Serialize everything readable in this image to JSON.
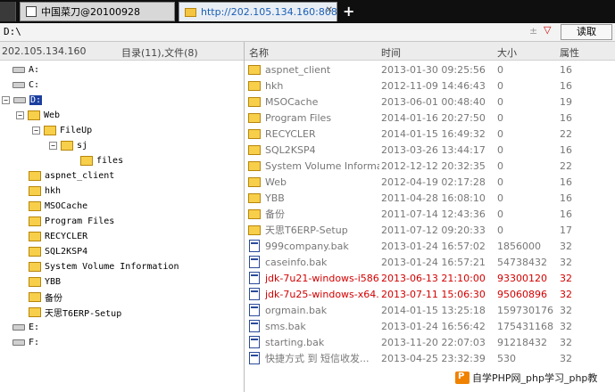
{
  "tabs": [
    {
      "label": ""
    },
    {
      "label": "中国菜刀@20100928"
    },
    {
      "label": "http://202.105.134.160:8080..."
    }
  ],
  "new_tab_label": "+",
  "address": {
    "path": "D:\\",
    "read_label": "读取",
    "controls": "±",
    "dropdown": "▽"
  },
  "left": {
    "ip": "202.105.134.160",
    "counts": "目录(11),文件(8)",
    "tree": [
      {
        "label": "A:",
        "type": "drive"
      },
      {
        "label": "C:",
        "type": "drive"
      },
      {
        "label": "D:",
        "type": "drive"
      },
      {
        "label": "Web",
        "type": "folder"
      },
      {
        "label": "FileUp",
        "type": "folder"
      },
      {
        "label": "sj",
        "type": "folder"
      },
      {
        "label": "files",
        "type": "folder"
      },
      {
        "label": "aspnet_client",
        "type": "folder"
      },
      {
        "label": "hkh",
        "type": "folder"
      },
      {
        "label": "MSOCache",
        "type": "folder"
      },
      {
        "label": "Program Files",
        "type": "folder"
      },
      {
        "label": "RECYCLER",
        "type": "folder"
      },
      {
        "label": "SQL2KSP4",
        "type": "folder"
      },
      {
        "label": "System Volume Information",
        "type": "folder"
      },
      {
        "label": "YBB",
        "type": "folder"
      },
      {
        "label": "备份",
        "type": "folder"
      },
      {
        "label": "天思T6ERP-Setup",
        "type": "folder"
      },
      {
        "label": "E:",
        "type": "drive"
      },
      {
        "label": "F:",
        "type": "drive"
      }
    ]
  },
  "columns": {
    "name": "名称",
    "time": "时间",
    "size": "大小",
    "attr": "属性"
  },
  "files": [
    {
      "name": "aspnet_client",
      "time": "2013-01-30 09:25:56",
      "size": "0",
      "attr": "16",
      "type": "folder"
    },
    {
      "name": "hkh",
      "time": "2012-11-09 14:46:43",
      "size": "0",
      "attr": "16",
      "type": "folder"
    },
    {
      "name": "MSOCache",
      "time": "2013-06-01 00:48:40",
      "size": "0",
      "attr": "19",
      "type": "folder"
    },
    {
      "name": "Program Files",
      "time": "2014-01-16 20:27:50",
      "size": "0",
      "attr": "16",
      "type": "folder"
    },
    {
      "name": "RECYCLER",
      "time": "2014-01-15 16:49:32",
      "size": "0",
      "attr": "22",
      "type": "folder"
    },
    {
      "name": "SQL2KSP4",
      "time": "2013-03-26 13:44:17",
      "size": "0",
      "attr": "16",
      "type": "folder"
    },
    {
      "name": "System Volume Informati...",
      "time": "2012-12-12 20:32:35",
      "size": "0",
      "attr": "22",
      "type": "folder"
    },
    {
      "name": "Web",
      "time": "2012-04-19 02:17:28",
      "size": "0",
      "attr": "16",
      "type": "folder"
    },
    {
      "name": "YBB",
      "time": "2011-04-28 16:08:10",
      "size": "0",
      "attr": "16",
      "type": "folder"
    },
    {
      "name": "备份",
      "time": "2011-07-14 12:43:36",
      "size": "0",
      "attr": "16",
      "type": "folder"
    },
    {
      "name": "天思T6ERP-Setup",
      "time": "2011-07-12 09:20:33",
      "size": "0",
      "attr": "17",
      "type": "folder"
    },
    {
      "name": "999company.bak",
      "time": "2013-01-24 16:57:02",
      "size": "1856000",
      "attr": "32",
      "type": "file"
    },
    {
      "name": "caseinfo.bak",
      "time": "2013-01-24 16:57:21",
      "size": "54738432",
      "attr": "32",
      "type": "file"
    },
    {
      "name": "jdk-7u21-windows-i586.e...",
      "time": "2013-06-13 21:10:00",
      "size": "93300120",
      "attr": "32",
      "type": "file",
      "red": true
    },
    {
      "name": "jdk-7u25-windows-x64.exe",
      "time": "2013-07-11 15:06:30",
      "size": "95060896",
      "attr": "32",
      "type": "file",
      "red": true
    },
    {
      "name": "orgmain.bak",
      "time": "2014-01-15 13:25:18",
      "size": "159730176",
      "attr": "32",
      "type": "file"
    },
    {
      "name": "sms.bak",
      "time": "2013-01-24 16:56:42",
      "size": "175431168",
      "attr": "32",
      "type": "file"
    },
    {
      "name": "starting.bak",
      "time": "2013-11-20 22:07:03",
      "size": "91218432",
      "attr": "32",
      "type": "file"
    },
    {
      "name": "快捷方式 到 短信收发...",
      "time": "2013-04-25 23:32:39",
      "size": "530",
      "attr": "32",
      "type": "file"
    }
  ],
  "watermark": "自学PHP网_php学习_php教"
}
